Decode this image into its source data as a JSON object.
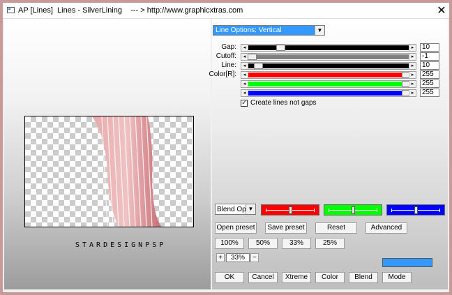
{
  "window": {
    "title": "AP [Lines]  Lines - SilverLining    --- > http://www.graphicxtras.com",
    "close_glyph": "✕"
  },
  "preview": {
    "watermark": "STARDESIGNPSP",
    "stripe_color": "#d88a8e"
  },
  "options": {
    "dropdown_value": "Line Options: Vertical"
  },
  "sliders": [
    {
      "label": "Gap:",
      "value": "10",
      "fill_color": "#000000",
      "fill_fraction": 1.0,
      "thumb_fraction": 0.2
    },
    {
      "label": "Cutoff:",
      "value": "-1",
      "fill_color": "#808080",
      "fill_fraction": 1.0,
      "thumb_fraction": 0.0
    },
    {
      "label": "Line:",
      "value": "10",
      "fill_color": "#000000",
      "fill_fraction": 1.0,
      "thumb_fraction": 0.06
    },
    {
      "label": "Color[R]:",
      "value": "255",
      "fill_color": "#ff0000",
      "fill_fraction": 1.0,
      "thumb_fraction": 1.0
    },
    {
      "label": "",
      "value": "255",
      "fill_color": "#00ff00",
      "fill_fraction": 1.0,
      "thumb_fraction": 1.0
    },
    {
      "label": "",
      "value": "255",
      "fill_color": "#0000ff",
      "fill_fraction": 1.0,
      "thumb_fraction": 1.0
    }
  ],
  "checkbox": {
    "label": "Create lines not gaps",
    "checked": true,
    "check_glyph": "✓"
  },
  "blend": {
    "select_value": "Blend Options",
    "color_sliders": [
      {
        "color": "#ff0000",
        "level": 0.5
      },
      {
        "color": "#00ff00",
        "level": 0.5
      },
      {
        "color": "#0000ff",
        "level": 0.5
      }
    ]
  },
  "buttons": {
    "open_preset": "Open preset",
    "save_preset": "Save preset",
    "reset": "Reset",
    "advanced": "Advanced",
    "zoom_100": "100%",
    "zoom_50": "50%",
    "zoom_33": "33%",
    "zoom_25": "25%",
    "ok": "OK",
    "cancel": "Cancel",
    "xtreme": "Xtreme",
    "color": "Color",
    "blend": "Blend",
    "mode": "Mode"
  },
  "zoom": {
    "plus": "+",
    "value": "33%",
    "minus": "−"
  },
  "swatch_color": "#3399ff"
}
